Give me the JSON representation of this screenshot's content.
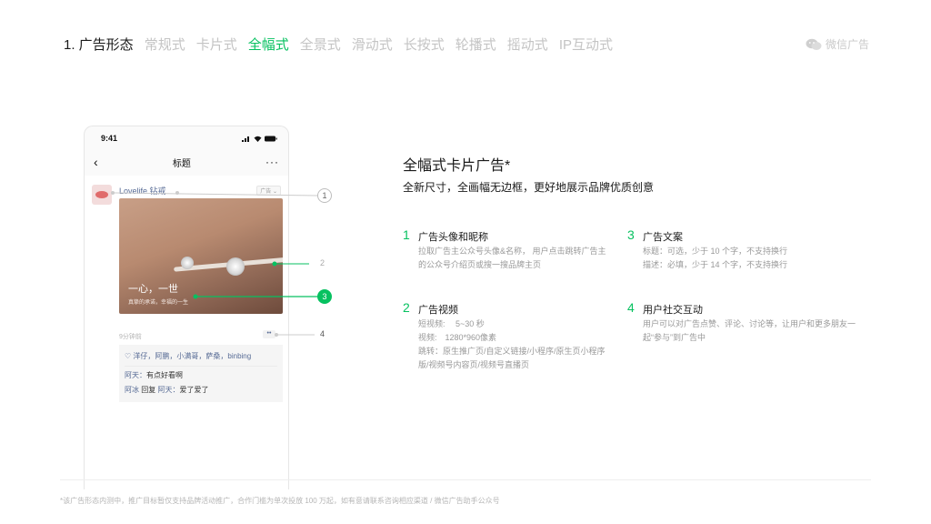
{
  "nav": {
    "section": "1. 广告形态",
    "tabs": [
      "常规式",
      "卡片式",
      "全幅式",
      "全景式",
      "滑动式",
      "长按式",
      "轮播式",
      "摇动式",
      "IP互动式"
    ],
    "active_index": 2
  },
  "brand": {
    "text": "微信广告",
    "icon": "wechat-icon"
  },
  "phone": {
    "time": "9:41",
    "title": "标题",
    "more": "···",
    "nickname": "Lovelife 钻戒",
    "ad_tag": "广告 ⌄",
    "caption_main": "一心，一世",
    "caption_sub": "真挚的承诺，幸福的一生",
    "post_time": "9分钟前",
    "dots": "••",
    "likes": "♡ 洋仔，阿鹏，小满哥，萨桑，binbing",
    "comment1_name": "阿天：",
    "comment1_text": "有点好看啊",
    "comment2_name": "阿冰",
    "comment2_mid": " 回复 ",
    "comment2_name2": "阿天：",
    "comment2_text": "爱了爱了"
  },
  "callouts": [
    "1",
    "2",
    "3",
    "4"
  ],
  "panel": {
    "title": "全幅式卡片广告*",
    "subtitle": "全新尺寸，全画幅无边框，更好地展示品牌优质创意",
    "features": [
      {
        "num": "1",
        "title": "广告头像和昵称",
        "desc": "拉取广告主公众号头像&名称， 用户点击跳转广告主的公众号介绍页或搜一搜品牌主页"
      },
      {
        "num": "2",
        "title": "广告视频",
        "desc_lines": [
          "短视频:　 5~30 秒",
          "视频:　1280*960像素",
          "跳转：原生推广页/自定义链接/小程序/原生页小程序版/视频号内容页/视频号直播页"
        ]
      },
      {
        "num": "3",
        "title": "广告文案",
        "desc_lines": [
          "标题：可选，少于 10 个字，不支持换行",
          "描述：必填，少于 14 个字，不支持换行"
        ]
      },
      {
        "num": "4",
        "title": "用户社交互动",
        "desc": "用户可以对广告点赞、评论、讨论等，让用户和更多朋友一起“参与”到广告中"
      }
    ]
  },
  "footnote": "*该广告形态内测中，推广目标暂仅支持品牌活动推广，合作门槛为单次投放 100 万起，如有意请联系咨询相应渠道 / 微信广告助手公众号",
  "colors": {
    "accent": "#07c160",
    "link": "#576b95",
    "muted": "#c4c4c4"
  }
}
